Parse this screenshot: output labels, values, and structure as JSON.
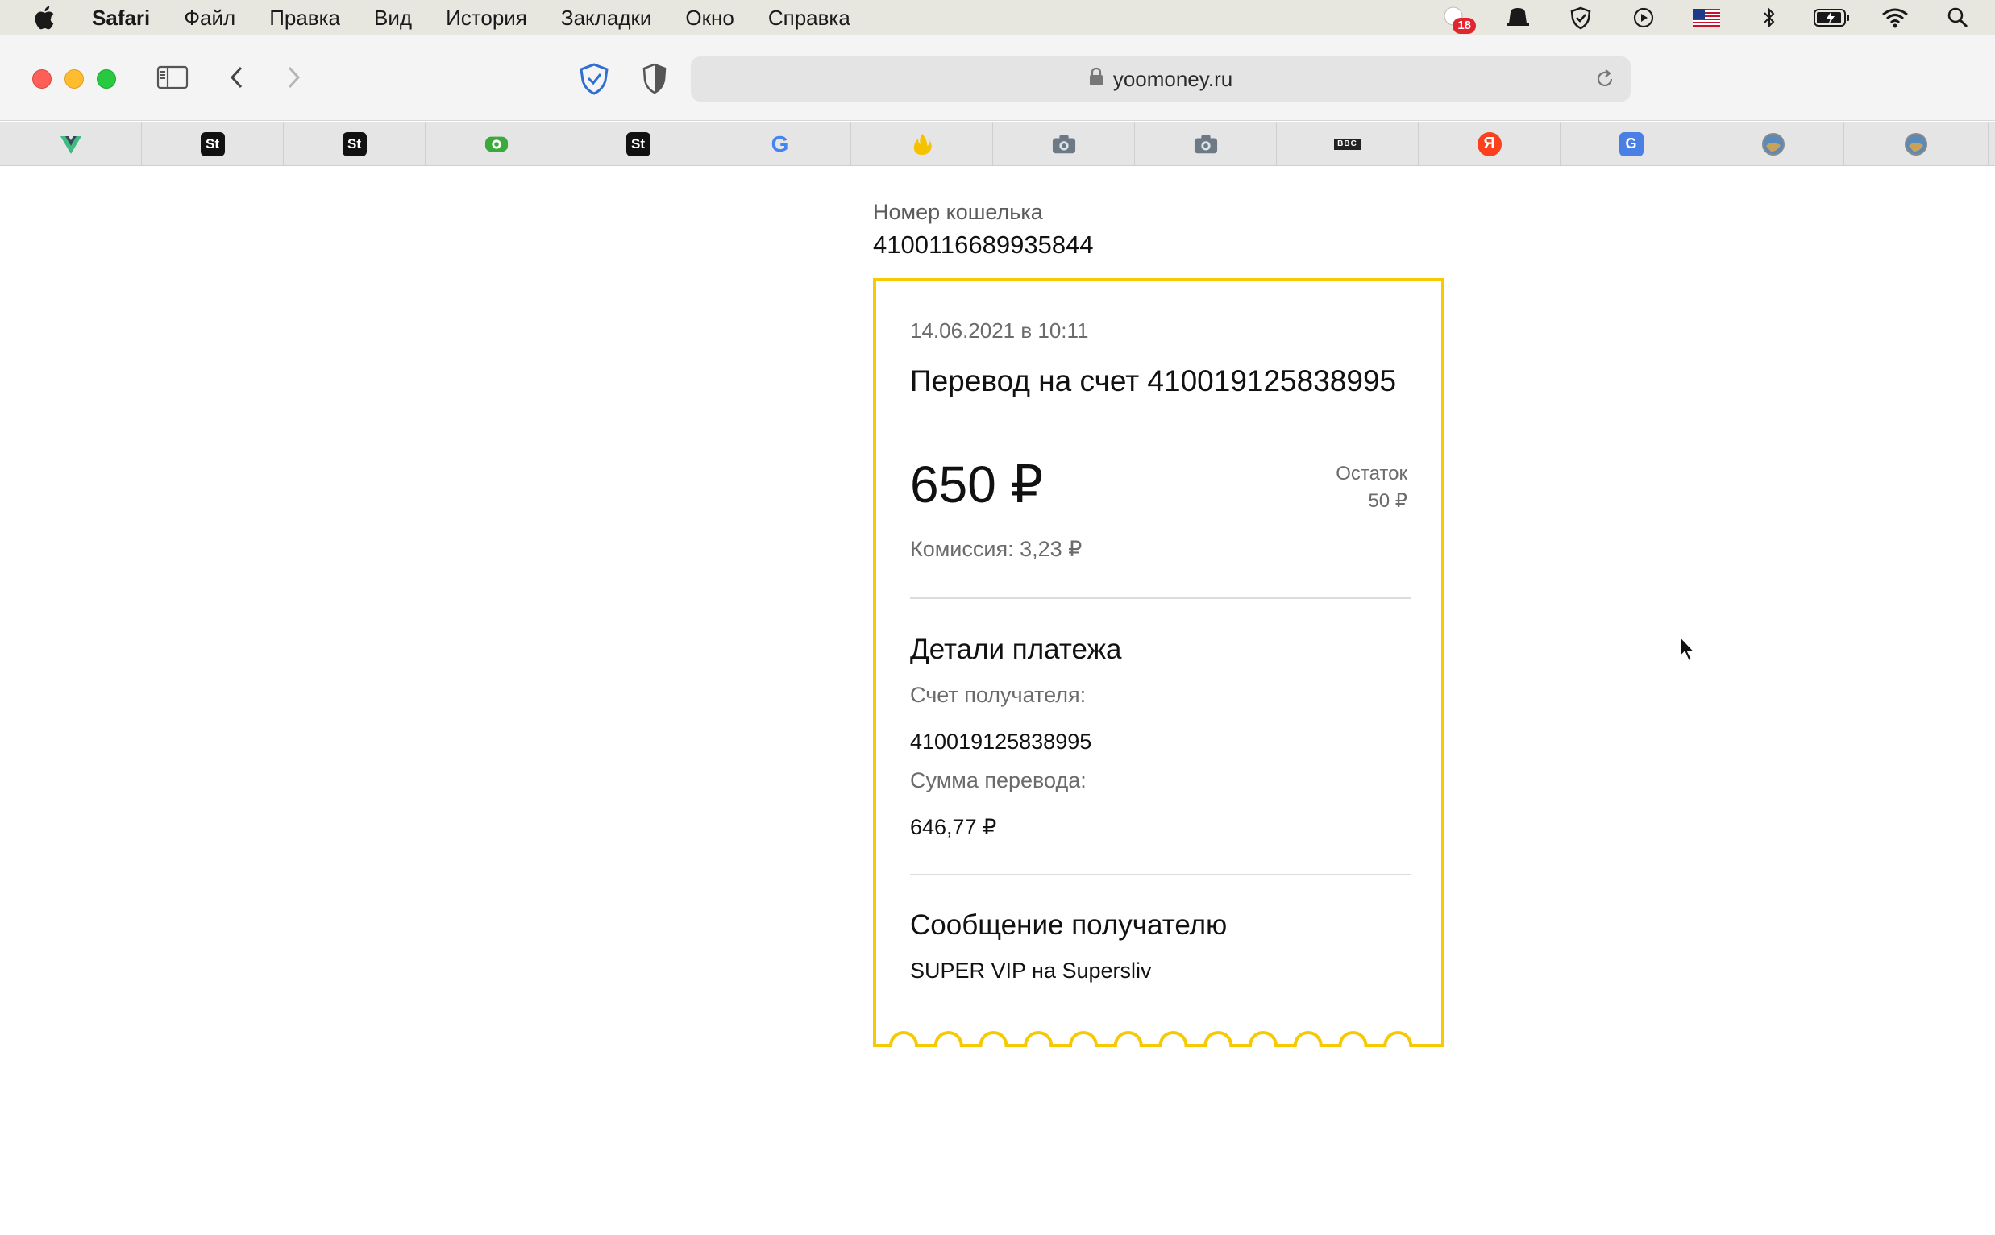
{
  "menubar": {
    "app_name": "Safari",
    "items": [
      "Файл",
      "Правка",
      "Вид",
      "История",
      "Закладки",
      "Окно",
      "Справка"
    ],
    "notification_count": "18"
  },
  "toolbar": {
    "url": "yoomoney.ru"
  },
  "tabs": [
    {
      "icon": "vue-icon"
    },
    {
      "icon": "st-icon",
      "text": "St"
    },
    {
      "icon": "st-icon",
      "text": "St"
    },
    {
      "icon": "money-icon"
    },
    {
      "icon": "st-icon",
      "text": "St"
    },
    {
      "icon": "google-icon",
      "text": "G"
    },
    {
      "icon": "flame-icon"
    },
    {
      "icon": "camera-icon"
    },
    {
      "icon": "camera-icon"
    },
    {
      "icon": "bbc-icon",
      "text": "BBC"
    },
    {
      "icon": "yandex-icon",
      "text": "Я"
    },
    {
      "icon": "translate-icon",
      "text": "G"
    },
    {
      "icon": "globe-icon"
    },
    {
      "icon": "globe-icon"
    }
  ],
  "page": {
    "wallet_label": "Номер кошелька",
    "wallet_number": "4100116689935844",
    "receipt": {
      "date": "14.06.2021 в 10:11",
      "title": "Перевод на счет 410019125838995",
      "amount": "650 ₽",
      "rest_label": "Остаток",
      "rest_value": "50 ₽",
      "fee": "Комиссия: 3,23 ₽",
      "details_heading": "Детали платежа",
      "recipient_label": "Счет получателя:",
      "recipient_value": "410019125838995",
      "sum_label": "Сумма перевода:",
      "sum_value": "646,77 ₽",
      "message_heading": "Сообщение получателю",
      "message_value": "SUPER VIP на Supersliv"
    }
  },
  "colors": {
    "receipt_border": "#f7c900",
    "menubar_bg": "#e8e7df",
    "toolbar_bg": "#f4f4f4",
    "tabbar_bg": "#e5e5e5"
  }
}
